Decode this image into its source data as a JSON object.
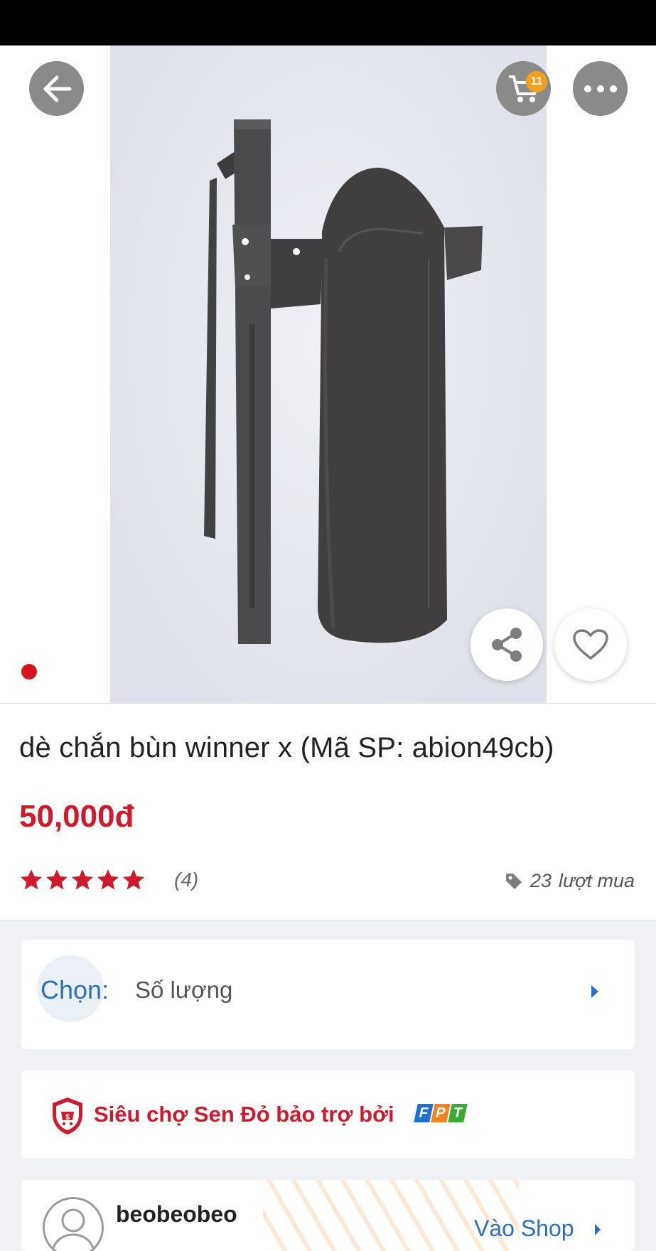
{
  "header": {
    "back_icon": "arrow-left-icon",
    "cart_icon": "cart-icon",
    "cart_badge": "11",
    "more_icon": "more-horizontal-icon"
  },
  "gallery": {
    "image_description_icon": "product-photo",
    "share_icon": "share-icon",
    "favorite_icon": "heart-icon",
    "active_dot_color": "#d7141a"
  },
  "product": {
    "title": "dè chắn bùn winner x  (Mã SP: abion49cb)",
    "price": "50,000đ",
    "rating_stars": 5,
    "rating_count": "(4)",
    "sold_count": "23",
    "sold_label": "lượt mua"
  },
  "options": {
    "label": "Chọn:",
    "value": "Số lượng"
  },
  "guarantee": {
    "text": "Siêu chợ Sen Đỏ bảo trợ bởi",
    "brand_letters": [
      "F",
      "P",
      "T"
    ]
  },
  "shop": {
    "name": "beobeobeo",
    "link_label": "Vào Shop"
  },
  "colors": {
    "accent_red": "#d0192b",
    "link_blue": "#2a6fc1",
    "badge_orange": "#f4a21c"
  }
}
